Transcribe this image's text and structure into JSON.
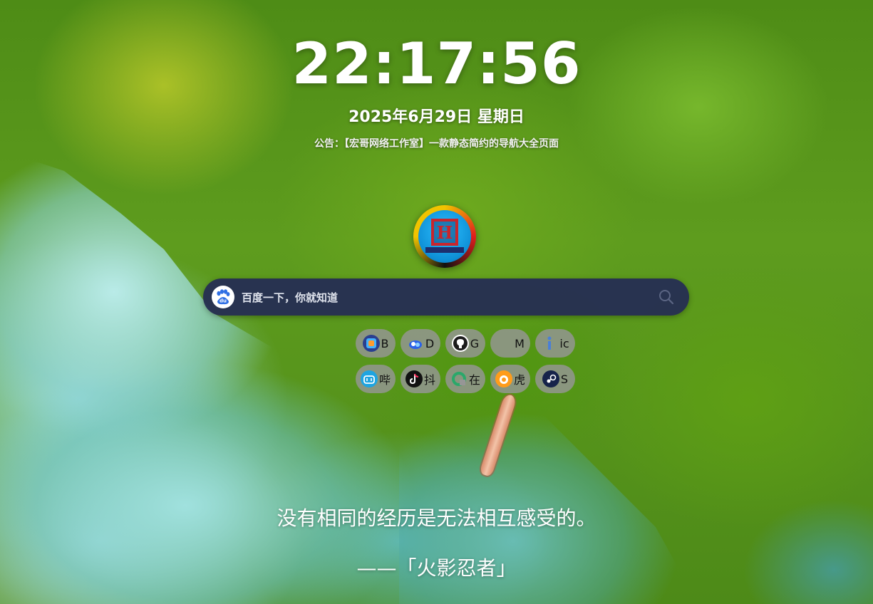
{
  "clock": {
    "time": "22:17:56",
    "date": "2025年6月29日 星期日"
  },
  "notice": "公告：【宏哥网络工作室】一款静态简约的导航大全页面",
  "logo": {
    "name": "logo-emblem"
  },
  "search": {
    "engine_icon": "baidu-paw-icon",
    "engine_icon_text": "du",
    "placeholder": "百度一下，你就知道",
    "button_icon": "search-icon"
  },
  "links": [
    {
      "label": "B",
      "icon": "blog-icon",
      "color": "#3a6fd8"
    },
    {
      "label": "D",
      "icon": "baidu-disk-icon",
      "color": "#2b62e8"
    },
    {
      "label": "G",
      "icon": "github-icon",
      "color": "#ffffff"
    },
    {
      "label": "M",
      "icon": "blank-icon",
      "color": "#8a8a8a"
    },
    {
      "label": "ic",
      "icon": "iconfont-icon",
      "color": "#6b6b6b"
    },
    {
      "label": "哔",
      "icon": "bilibili-icon",
      "color": "#1fa4e0"
    },
    {
      "label": "抖",
      "icon": "douyin-icon",
      "color": "#111111"
    },
    {
      "label": "在",
      "icon": "online-tools-icon",
      "color": "#2aa86a"
    },
    {
      "label": "虎",
      "icon": "huya-icon",
      "color": "#ff9c1a"
    },
    {
      "label": "S",
      "icon": "steam-icon",
      "color": "#16234a"
    }
  ],
  "quote": {
    "text": "没有相同的经历是无法相互感受的。",
    "source": "——「火影忍者」"
  },
  "colors": {
    "search_bg": "#263052",
    "chip_bg": "#969696"
  }
}
